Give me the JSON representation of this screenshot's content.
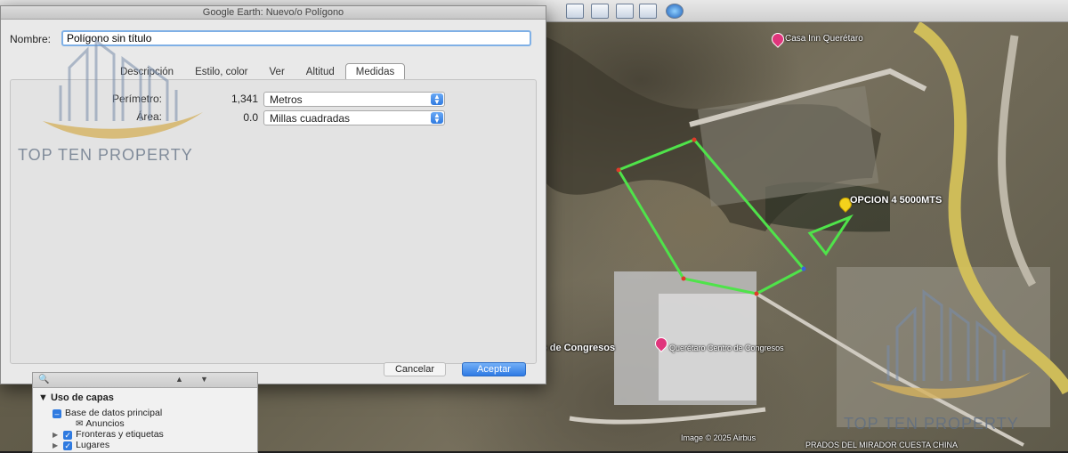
{
  "window": {
    "title": "Google Earth: Nuevo/o Polígono"
  },
  "dialog": {
    "name_label": "Nombre:",
    "name_value": "Polígono sin título",
    "tabs": [
      {
        "label": "Descripción",
        "active": false
      },
      {
        "label": "Estilo, color",
        "active": false
      },
      {
        "label": "Ver",
        "active": false
      },
      {
        "label": "Altitud",
        "active": false
      },
      {
        "label": "Medidas",
        "active": true
      }
    ],
    "perimeter": {
      "label": "Perímetro:",
      "value": "1,341",
      "unit": "Metros"
    },
    "area": {
      "label": "Área:",
      "value": "0.0",
      "unit": "Millas cuadradas"
    },
    "cancel_label": "Cancelar",
    "accept_label": "Aceptar"
  },
  "layers": {
    "header": "▼ Uso de capas",
    "items": [
      {
        "label": "Base de datos principal",
        "state": "partial"
      },
      {
        "label": "Anuncios",
        "state": "none"
      },
      {
        "label": "Fronteras y etiquetas",
        "state": "checked"
      },
      {
        "label": "Lugares",
        "state": "checked"
      }
    ]
  },
  "map": {
    "labels": {
      "hotel": "Casa Inn Querétaro",
      "option": "OPCION  4 5000MTS",
      "congress_left": "tro de Congresos",
      "congress_right": "Querétaro Centro de Congresos",
      "copyright": "Image © 2025 Airbus",
      "neighborhood": "PRADOS DEL MIRADOR CUESTA CHINA"
    },
    "colors": {
      "polygon": "#4fe34a",
      "vertex": "#e03a2a",
      "highway": "#d4c15a",
      "pin_yellow": "#f3d21c",
      "pin_pink": "#e0357c"
    }
  },
  "watermark": {
    "text": "TOP TEN PROPERTY"
  }
}
